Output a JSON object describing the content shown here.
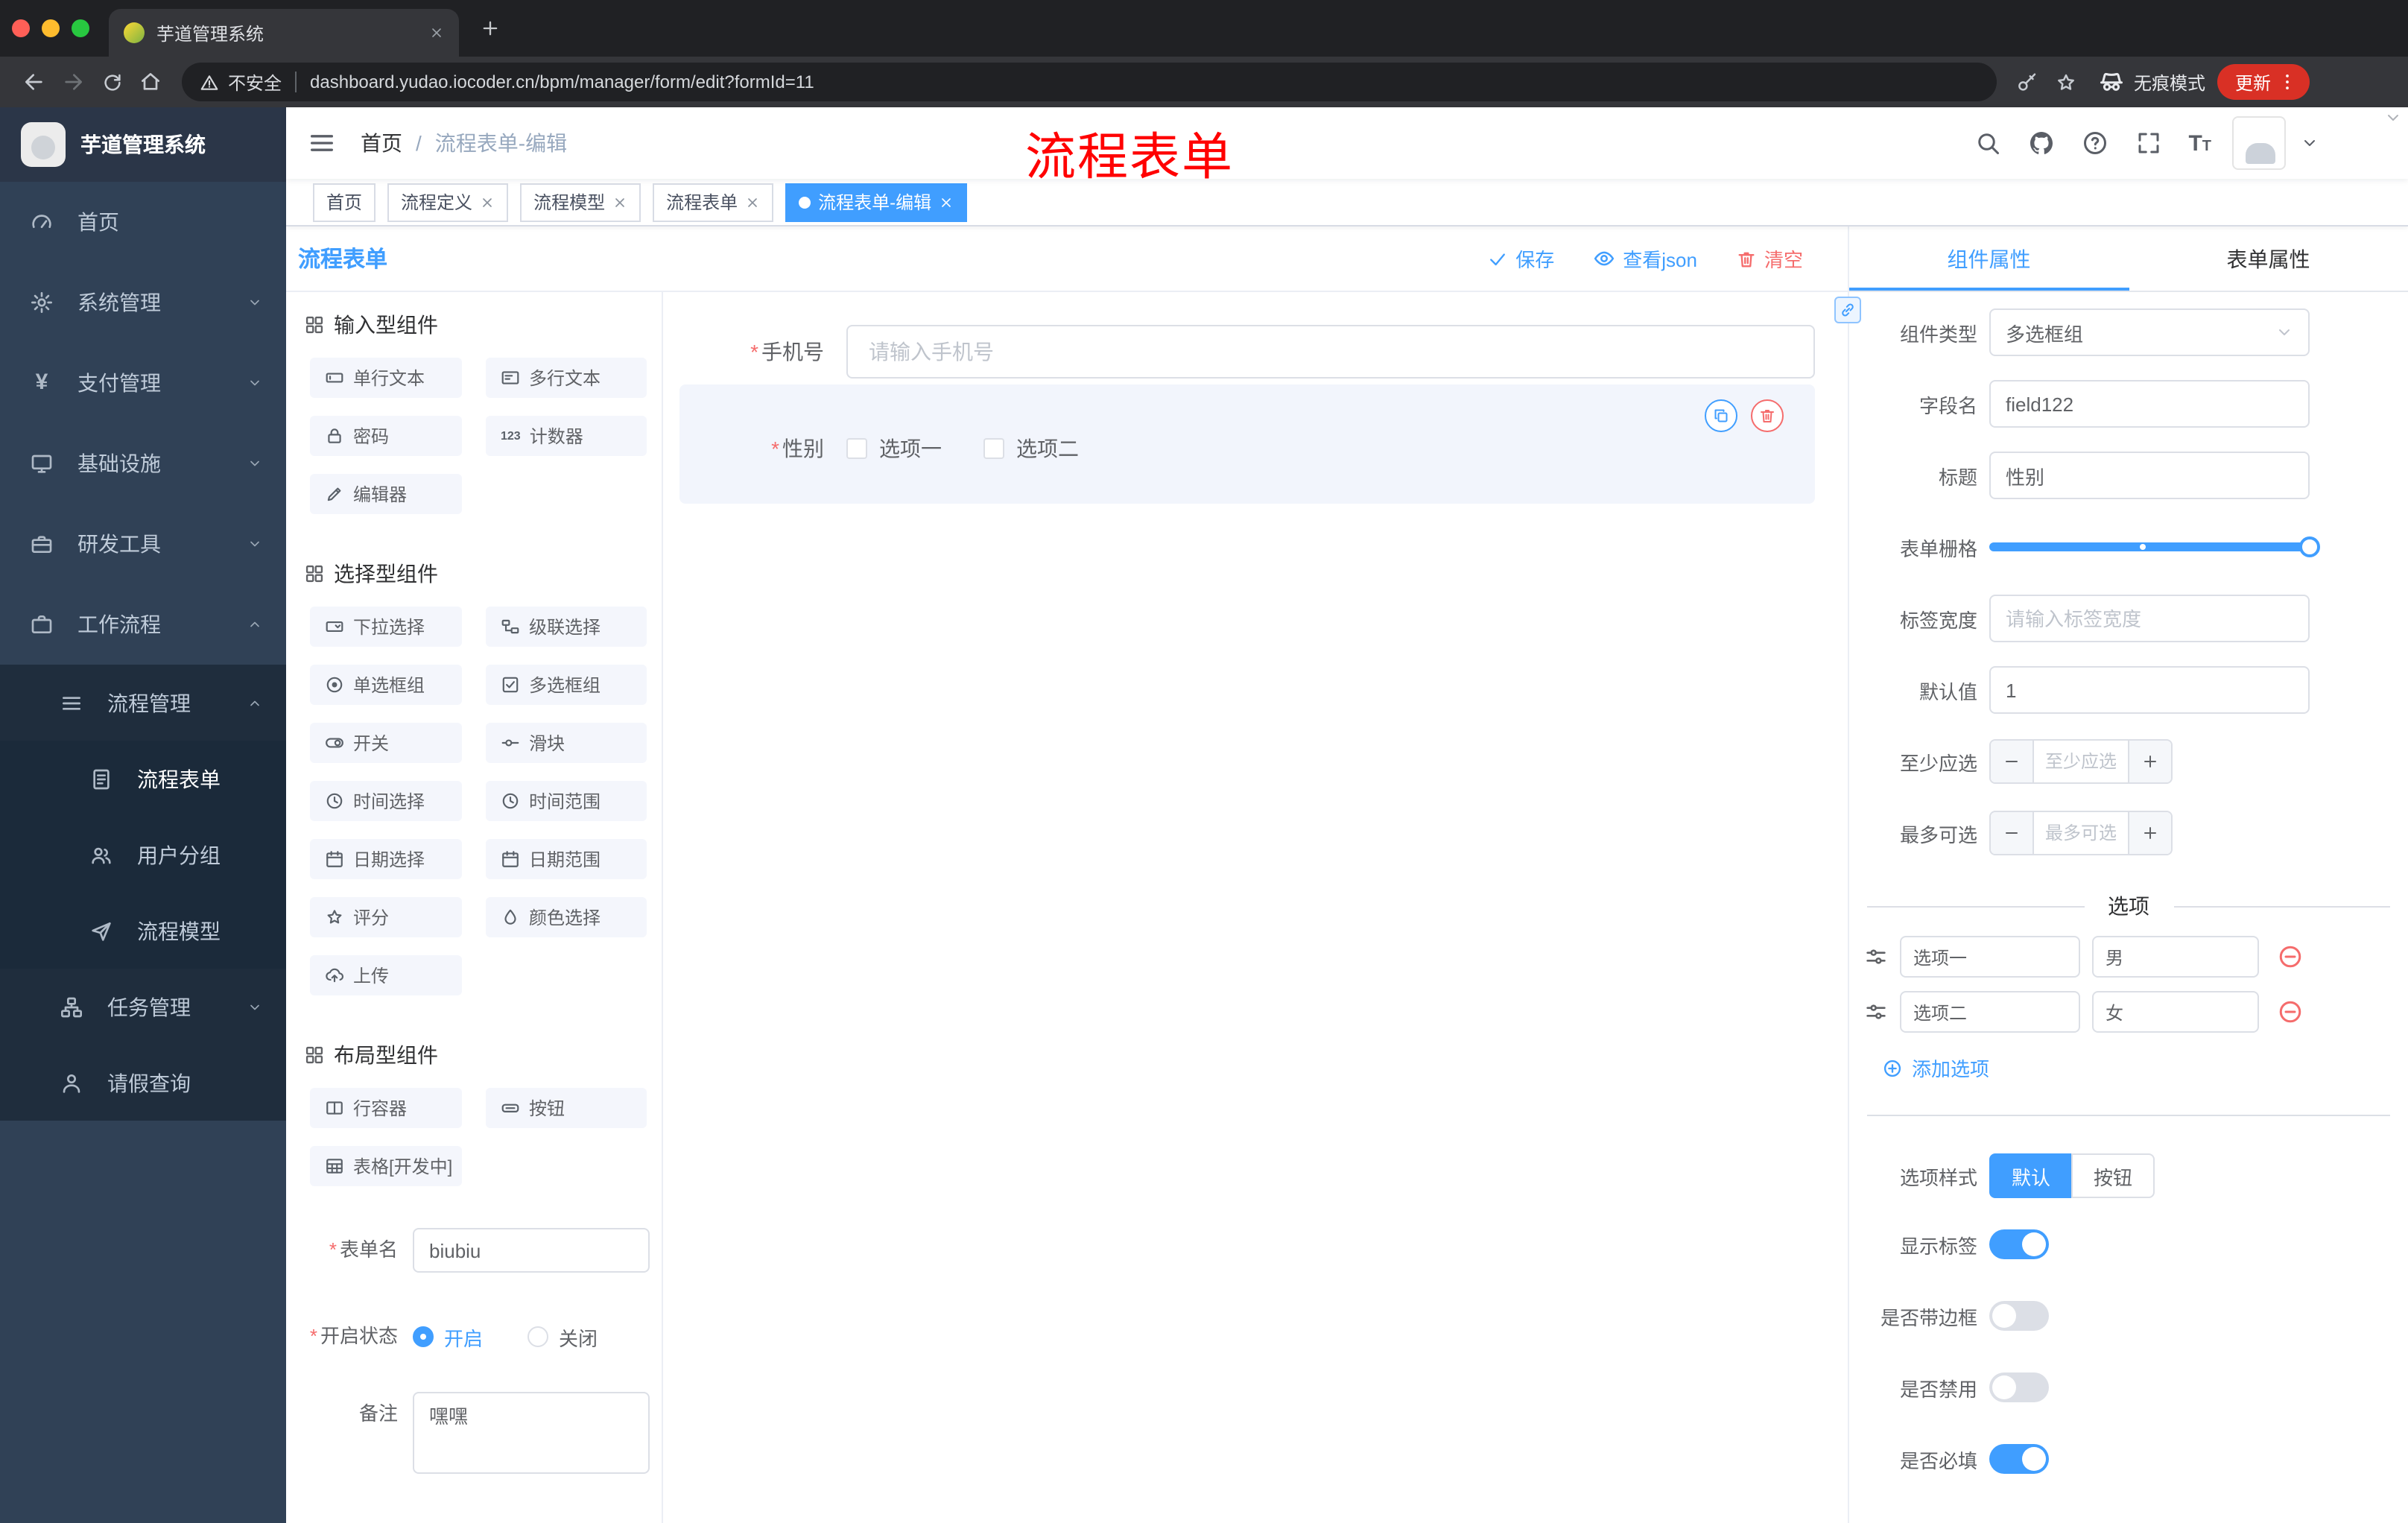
{
  "browser": {
    "tab_title": "芋道管理系统",
    "security_label": "不安全",
    "url": "dashboard.yudao.iocoder.cn/bpm/manager/form/edit?formId=11",
    "incognito_label": "无痕模式",
    "update_label": "更新"
  },
  "header": {
    "breadcrumb_home": "首页",
    "breadcrumb_sep": "/",
    "breadcrumb_current": "流程表单-编辑",
    "annotation": "流程表单",
    "font_icon_text": "T"
  },
  "sidebar": {
    "logo_title": "芋道管理系统",
    "payment_symbol": "¥",
    "items": [
      {
        "label": "首页",
        "icon": "dashboard-icon"
      },
      {
        "label": "系统管理",
        "icon": "gear-icon",
        "arrow": "down"
      },
      {
        "label": "支付管理",
        "icon": "payment-icon",
        "arrow": "down"
      },
      {
        "label": "基础设施",
        "icon": "infrastructure-icon",
        "arrow": "down"
      },
      {
        "label": "研发工具",
        "icon": "devtools-icon",
        "arrow": "down"
      },
      {
        "label": "工作流程",
        "icon": "workflow-icon",
        "arrow": "up"
      },
      {
        "label": "流程管理",
        "icon": "process-manage-icon",
        "arrow": "up"
      },
      {
        "label": "流程表单",
        "icon": "process-form-icon",
        "active": true
      },
      {
        "label": "用户分组",
        "icon": "user-group-icon"
      },
      {
        "label": "流程模型",
        "icon": "process-model-icon"
      },
      {
        "label": "任务管理",
        "icon": "task-manage-icon",
        "arrow": "down"
      },
      {
        "label": "请假查询",
        "icon": "leave-query-icon"
      }
    ]
  },
  "tags": [
    {
      "label": "首页",
      "closable": false,
      "active": false
    },
    {
      "label": "流程定义",
      "closable": true,
      "active": false
    },
    {
      "label": "流程模型",
      "closable": true,
      "active": false
    },
    {
      "label": "流程表单",
      "closable": true,
      "active": false
    },
    {
      "label": "流程表单-编辑",
      "closable": true,
      "active": true
    }
  ],
  "editor": {
    "title": "流程表单",
    "save": "保存",
    "view_json": "查看json",
    "clear": "清空"
  },
  "palette": {
    "sections": [
      {
        "title": "输入型组件",
        "items": [
          {
            "label": "单行文本",
            "icon": "single-line-icon"
          },
          {
            "label": "多行文本",
            "icon": "multi-line-icon"
          },
          {
            "label": "密码",
            "icon": "lock-icon"
          },
          {
            "label": "计数器",
            "icon": "counter-icon",
            "icon_text": "123"
          },
          {
            "label": "编辑器",
            "icon": "editor-icon"
          }
        ]
      },
      {
        "title": "选择型组件",
        "items": [
          {
            "label": "下拉选择",
            "icon": "select-icon"
          },
          {
            "label": "级联选择",
            "icon": "cascade-icon"
          },
          {
            "label": "单选框组",
            "icon": "radio-group-icon"
          },
          {
            "label": "多选框组",
            "icon": "checkbox-group-icon"
          },
          {
            "label": "开关",
            "icon": "switch-icon"
          },
          {
            "label": "滑块",
            "icon": "slider-icon"
          },
          {
            "label": "时间选择",
            "icon": "time-picker-icon"
          },
          {
            "label": "时间范围",
            "icon": "time-range-icon"
          },
          {
            "label": "日期选择",
            "icon": "date-picker-icon"
          },
          {
            "label": "日期范围",
            "icon": "date-range-icon"
          },
          {
            "label": "评分",
            "icon": "rate-icon"
          },
          {
            "label": "颜色选择",
            "icon": "color-picker-icon"
          },
          {
            "label": "上传",
            "icon": "upload-icon"
          }
        ]
      },
      {
        "title": "布局型组件",
        "items": [
          {
            "label": "行容器",
            "icon": "row-container-icon"
          },
          {
            "label": "按钮",
            "icon": "button-icon"
          },
          {
            "label": "表格[开发中]",
            "icon": "table-icon"
          }
        ]
      }
    ]
  },
  "form_meta": {
    "name_label": "表单名",
    "name_value": "biubiu",
    "status_label": "开启状态",
    "status_on": "开启",
    "status_off": "关闭",
    "remark_label": "备注",
    "remark_value": "嘿嘿"
  },
  "canvas": {
    "phone_label": "手机号",
    "phone_placeholder": "请输入手机号",
    "gender_label": "性别",
    "gender_option1": "选项一",
    "gender_option2": "选项二"
  },
  "props": {
    "tab_component": "组件属性",
    "tab_form": "表单属性",
    "type_label": "组件类型",
    "type_value": "多选框组",
    "field_label": "字段名",
    "field_value": "field122",
    "title_label": "标题",
    "title_value": "性别",
    "grid_label": "表单栅格",
    "labelw_label": "标签宽度",
    "labelw_placeholder": "请输入标签宽度",
    "default_label": "默认值",
    "default_value": "1",
    "min_label": "至少应选",
    "min_placeholder": "至少应选",
    "max_label": "最多可选",
    "max_placeholder": "最多可选",
    "options_title": "选项",
    "options": [
      {
        "label": "选项一",
        "value": "男"
      },
      {
        "label": "选项二",
        "value": "女"
      }
    ],
    "add_label": "添加选项",
    "style_label": "选项样式",
    "style_default": "默认",
    "style_button": "按钮",
    "toggles": [
      {
        "label": "显示标签",
        "on": true
      },
      {
        "label": "是否带边框",
        "on": false
      },
      {
        "label": "是否禁用",
        "on": false
      },
      {
        "label": "是否必填",
        "on": true
      }
    ]
  },
  "glyphs": {
    "required": "*"
  },
  "colors": {
    "accent": "#409eff",
    "danger": "#f56c6c",
    "annotation": "#ff0000",
    "sidebar_bg": "#304156",
    "submenu_bg": "#1f2d3d",
    "chrome_bg": "#202124",
    "update_pill": "#d93025"
  },
  "icons": {
    "browser": [
      "back-icon",
      "forward-icon",
      "reload-icon",
      "home-icon",
      "warning-icon",
      "key-icon",
      "bookmark-star-icon",
      "incognito-icon",
      "menu-dots-icon",
      "new-tab-icon",
      "close-icon"
    ],
    "app_header": [
      "hamburger-icon",
      "search-icon",
      "github-icon",
      "help-icon",
      "fullscreen-icon",
      "font-size-icon",
      "caret-down-icon"
    ],
    "editor": [
      "check-icon",
      "eye-icon",
      "trash-icon"
    ],
    "props": [
      "link-icon",
      "chevron-down-icon",
      "tune-icon",
      "minus-circle-icon",
      "plus-circle-icon",
      "copy-icon",
      "delete-icon",
      "drag-handle-icon"
    ]
  }
}
